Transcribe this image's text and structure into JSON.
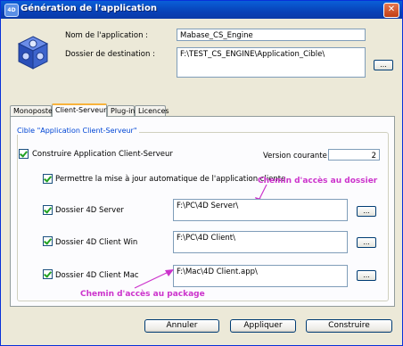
{
  "window": {
    "title": "Génération de l'application",
    "logo_text": "4D"
  },
  "app_name": {
    "label": "Nom de l'application  :",
    "value": "Mabase_CS_Engine"
  },
  "destination": {
    "label": "Dossier de destination :",
    "value": "F:\\TEST_CS_ENGINE\\Application_Cible\\",
    "browse_label": "..."
  },
  "tabs": [
    {
      "label": "Monoposte",
      "active": false
    },
    {
      "label": "Client-Serveur",
      "active": true
    },
    {
      "label": "Plug-ins",
      "active": false
    },
    {
      "label": "Licences",
      "active": false
    }
  ],
  "group": {
    "title": "Cible \"Application Client-Serveur\""
  },
  "build_cs": {
    "label": "Construire Application Client-Serveur",
    "checked": true
  },
  "version": {
    "label": "Version courante :",
    "value": "2"
  },
  "auto_update": {
    "label": "Permettre la mise à jour automatique de l'application cliente",
    "checked": true
  },
  "server": {
    "label": "Dossier 4D Server",
    "path": "F:\\PC\\4D Server\\",
    "checked": true,
    "browse_label": "..."
  },
  "client_win": {
    "label": "Dossier 4D Client Win",
    "path": "F:\\PC\\4D Client\\",
    "checked": true,
    "browse_label": "..."
  },
  "client_mac": {
    "label": "Dossier 4D Client Mac",
    "path": "F:\\Mac\\4D Client.app\\",
    "checked": true,
    "browse_label": "..."
  },
  "annotations": {
    "folder_path": "Chemin d'accès au dossier",
    "package_path": "Chemin d'accès au package"
  },
  "buttons": {
    "cancel": "Annuler",
    "apply": "Appliquer",
    "build": "Construire"
  },
  "colors": {
    "annotation": "#cc33cc",
    "title_bar": "#0a5fd8",
    "group_title": "#0046d5"
  }
}
